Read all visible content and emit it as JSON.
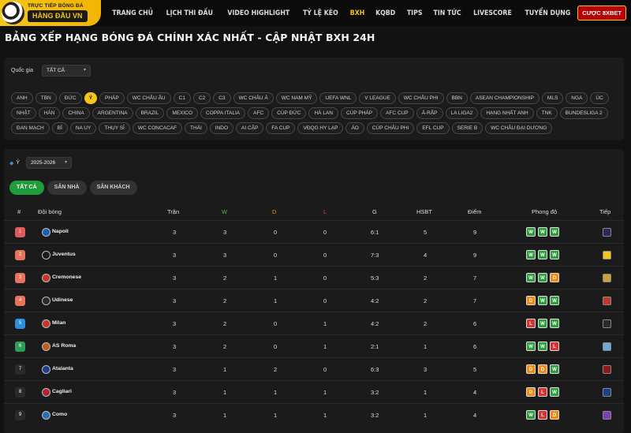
{
  "header": {
    "logo_tagline": "TRỰC TIẾP BÓNG ĐÁ",
    "logo_title": "HÀNG ĐẦU VN",
    "nav": [
      "TRANG CHỦ",
      "LỊCH THI ĐẤU",
      "VIDEO HIGHLIGHT",
      "TỶ LỆ KÈO",
      "BXH",
      "KQBD",
      "TIPS",
      "TIN TỨC",
      "LIVESCORE",
      "TUYỂN DỤNG"
    ],
    "active_nav": "BXH",
    "cta_label": "CƯỢC 8XBET"
  },
  "page_title": "BẢNG XẾP HẠNG BÓNG ĐÁ CHÍNH XÁC NHẤT - CẬP NHẬT BXH 24H",
  "filter": {
    "country_label": "Quốc gia",
    "country_value": "TẤT CẢ",
    "leagues": [
      "ANH",
      "TBN",
      "ĐỨC",
      "Ý",
      "PHÁP",
      "WC CHÂU ÂU",
      "C1",
      "C2",
      "C3",
      "WC CHÂU Á",
      "WC NAM MỸ",
      "UEFA WNL",
      "V LEAGUE",
      "WC CHÂU PHI",
      "BBN",
      "ASEAN CHAMPIONSHIP",
      "MLS",
      "NGA",
      "ÚC",
      "NHẬT",
      "HÀN",
      "CHINA",
      "ARGENTINA",
      "BRAZIL",
      "MEXICO",
      "COPPA ITALIA",
      "AFC",
      "CÚP ĐỨC",
      "HÀ LAN",
      "CÚP PHÁP",
      "AFC CUP",
      "Ả-RẬP",
      "LA LIGA2",
      "HẠNG NHẤT ANH",
      "TNK",
      "BUNDESLIGA 2",
      "ĐAN MẠCH",
      "BỈ",
      "NA UY",
      "THỤY SĨ",
      "WC CONCACAF",
      "THÁI",
      "INDO",
      "AI CẬP",
      "FA CUP",
      "VĐQG HY LẠP",
      "ÁO",
      "CÚP CHÂU PHI",
      "EFL CUP",
      "SERIE B",
      "WC CHÂU ĐẠI DƯƠNG"
    ],
    "active_league": "Ý"
  },
  "standings": {
    "league_label": "Ý",
    "season": "2025-2026",
    "tabs": [
      "TẤT CẢ",
      "SÂN NHÀ",
      "SÂN KHÁCH"
    ],
    "active_tab": "TẤT CẢ",
    "columns": {
      "rank": "#",
      "team": "Đội bóng",
      "played": "Trận",
      "w": "W",
      "d": "D",
      "l": "L",
      "goals": "G",
      "gd": "HSBT",
      "pts": "Điểm",
      "form": "Phong độ",
      "next": "Tiếp"
    },
    "rows": [
      {
        "rank": "1",
        "team": "Napoli",
        "played": "3",
        "w": "3",
        "d": "0",
        "l": "0",
        "goals": "6:1",
        "gd": "5",
        "pts": "9",
        "form": [
          "W",
          "W",
          "W"
        ]
      },
      {
        "rank": "2",
        "team": "Juventus",
        "played": "3",
        "w": "3",
        "d": "0",
        "l": "0",
        "goals": "7:3",
        "gd": "4",
        "pts": "9",
        "form": [
          "W",
          "W",
          "W"
        ]
      },
      {
        "rank": "3",
        "team": "Cremonese",
        "played": "3",
        "w": "2",
        "d": "1",
        "l": "0",
        "goals": "5:3",
        "gd": "2",
        "pts": "7",
        "form": [
          "W",
          "W",
          "D"
        ]
      },
      {
        "rank": "4",
        "team": "Udinese",
        "played": "3",
        "w": "2",
        "d": "1",
        "l": "0",
        "goals": "4:2",
        "gd": "2",
        "pts": "7",
        "form": [
          "D",
          "W",
          "W"
        ]
      },
      {
        "rank": "5",
        "team": "Milan",
        "played": "3",
        "w": "2",
        "d": "0",
        "l": "1",
        "goals": "4:2",
        "gd": "2",
        "pts": "6",
        "form": [
          "L",
          "W",
          "W"
        ]
      },
      {
        "rank": "6",
        "team": "AS Roma",
        "played": "3",
        "w": "2",
        "d": "0",
        "l": "1",
        "goals": "2:1",
        "gd": "1",
        "pts": "6",
        "form": [
          "W",
          "W",
          "L"
        ]
      },
      {
        "rank": "7",
        "team": "Atalanta",
        "played": "3",
        "w": "1",
        "d": "2",
        "l": "0",
        "goals": "6:3",
        "gd": "3",
        "pts": "5",
        "form": [
          "D",
          "D",
          "W"
        ]
      },
      {
        "rank": "8",
        "team": "Cagliari",
        "played": "3",
        "w": "1",
        "d": "1",
        "l": "1",
        "goals": "3:2",
        "gd": "1",
        "pts": "4",
        "form": [
          "D",
          "L",
          "W"
        ]
      },
      {
        "rank": "9",
        "team": "Como",
        "played": "3",
        "w": "1",
        "d": "1",
        "l": "1",
        "goals": "3:2",
        "gd": "1",
        "pts": "4",
        "form": [
          "W",
          "L",
          "D"
        ]
      }
    ]
  },
  "colors": {
    "accent": "#f5c518",
    "win": "#2e9e3e",
    "draw": "#f08a12",
    "loss": "#d63333",
    "header_w": "#3fbf4f",
    "header_d": "#f08a12",
    "header_l": "#e04040",
    "rank_1": "#e05a5a",
    "rank_2_4": "#e8725e",
    "rank_5": "#2e8fe0",
    "rank_6": "#2f9e56",
    "rank_other": "#2a2a2a",
    "team_logos": [
      "#1a5fb4",
      "#1a1a1a",
      "#c0392b",
      "#2a2a2a",
      "#c0392b",
      "#c25c1b",
      "#1f3f8a",
      "#b22234",
      "#2a6fb5"
    ],
    "next_logos": [
      "#2a2a5a",
      "#f5c518",
      "#c9a23a",
      "#c0392b",
      "#2a2a2a",
      "#6fa8dc",
      "#8b1a1a",
      "#1f3f8a",
      "#7b3fb5"
    ]
  }
}
